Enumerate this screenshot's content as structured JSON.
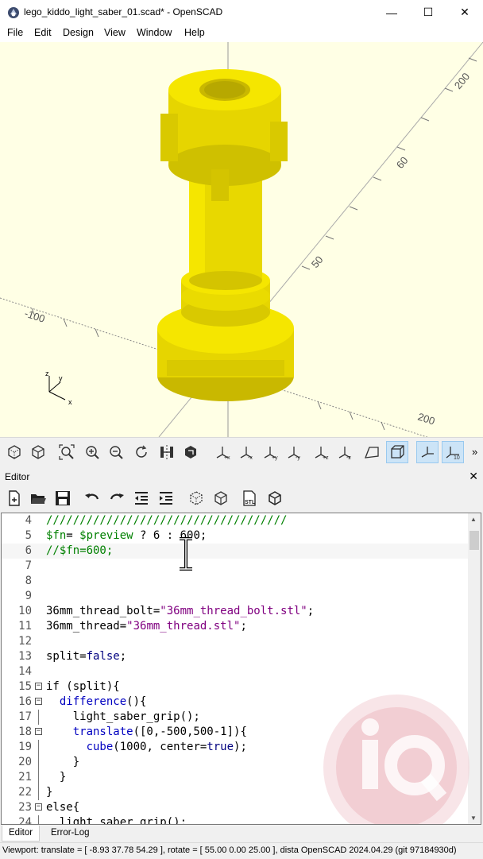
{
  "window": {
    "title": "lego_kiddo_light_saber_01.scad* - OpenSCAD",
    "minimize": "—",
    "maximize": "☐",
    "close": "✕"
  },
  "menu": [
    "File",
    "Edit",
    "Design",
    "View",
    "Window",
    "Help"
  ],
  "viewport": {
    "background": "#ffffe5",
    "model_color": "#f5e600",
    "axis_labels": {
      "neg100": "-100",
      "p50": "50",
      "p60": "60",
      "p200": "200"
    },
    "gizmo": {
      "z": "z",
      "y": "y",
      "x": "x"
    }
  },
  "view_toolbar": {
    "icons": [
      "render-icon",
      "preview-icon",
      "view-all-icon",
      "zoom-in-icon",
      "zoom-out-icon",
      "reset-view-icon",
      "mirror-icon",
      "flip-icon",
      "view-right-icon",
      "view-left-icon",
      "view-top-icon",
      "view-bottom-icon",
      "view-front-icon",
      "view-back-icon",
      "perspective-icon",
      "orthogonal-icon",
      "show-axes-icon",
      "show-scale-icon"
    ],
    "more": "»"
  },
  "editor": {
    "dock_title": "Editor",
    "close": "✕",
    "toolbar_icons": [
      "new-file-icon",
      "open-file-icon",
      "save-icon",
      "undo-icon",
      "redo-icon",
      "unindent-icon",
      "indent-icon",
      "preview-icon",
      "render-icon",
      "export-stl-icon",
      "send-to-print-icon"
    ],
    "stl_label": "STL",
    "lines": [
      {
        "n": "4",
        "text": "////////////////////////////////////"
      },
      {
        "n": "5",
        "text": "$fn= $preview ? 6 : 600;"
      },
      {
        "n": "6",
        "text": "//$fn=600;"
      },
      {
        "n": "7",
        "text": ""
      },
      {
        "n": "8",
        "text": ""
      },
      {
        "n": "9",
        "text": ""
      },
      {
        "n": "10",
        "text": "36mm_thread_bolt=\"36mm_thread_bolt.stl\";"
      },
      {
        "n": "11",
        "text": "36mm_thread=\"36mm_thread.stl\";"
      },
      {
        "n": "12",
        "text": ""
      },
      {
        "n": "13",
        "text": "split=false;"
      },
      {
        "n": "14",
        "text": ""
      },
      {
        "n": "15",
        "text": "if (split){"
      },
      {
        "n": "16",
        "text": "  difference(){"
      },
      {
        "n": "17",
        "text": "    light_saber_grip();"
      },
      {
        "n": "18",
        "text": "    translate([0,-500,500-1]){"
      },
      {
        "n": "19",
        "text": "      cube(1000, center=true);"
      },
      {
        "n": "20",
        "text": "    }"
      },
      {
        "n": "21",
        "text": "  }"
      },
      {
        "n": "22",
        "text": "}"
      },
      {
        "n": "23",
        "text": "else{"
      },
      {
        "n": "24",
        "text": "  light_saber_grip();"
      }
    ]
  },
  "tabs": [
    "Editor",
    "Error-Log"
  ],
  "status": "Viewport: translate = [ -8.93 37.78 54.29 ], rotate = [ 55.00 0.00 25.00 ], dista  OpenSCAD 2024.04.29 (git 97184930d)"
}
